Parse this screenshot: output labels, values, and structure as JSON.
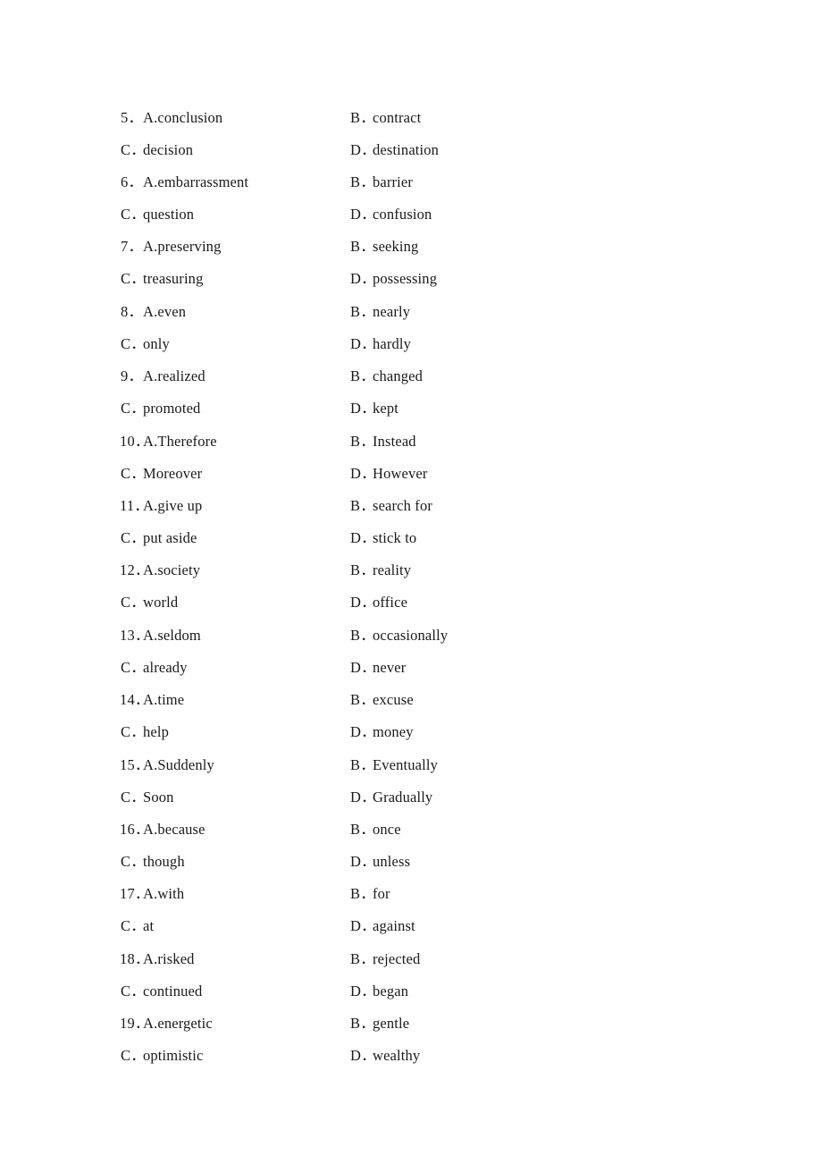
{
  "document": {
    "type": "cloze-test-answer-options",
    "page_background": "#ffffff",
    "text_color": "#1a1a1a",
    "a_label": "A.",
    "c_label": "C",
    "b_label": "B",
    "d_label": "D",
    "period": "．"
  },
  "questions": [
    {
      "number": "5",
      "number_label": "5．",
      "a_label": "A.conclusion",
      "b_letter": "B",
      "b_text": "contract",
      "c_letter": "C",
      "c_text": "decision",
      "d_letter": "D",
      "d_text": "destination"
    },
    {
      "number": "6",
      "number_label": "6．",
      "a_label": "A.embarrassment",
      "b_letter": "B",
      "b_text": "barrier",
      "c_letter": "C",
      "c_text": "question",
      "d_letter": "D",
      "d_text": "confusion"
    },
    {
      "number": "7",
      "number_label": "7．",
      "a_label": "A.preserving",
      "b_letter": "B",
      "b_text": "seeking",
      "c_letter": "C",
      "c_text": "treasuring",
      "d_letter": "D",
      "d_text": "possessing"
    },
    {
      "number": "8",
      "number_label": "8．",
      "a_label": "A.even",
      "b_letter": "B",
      "b_text": "nearly",
      "c_letter": "C",
      "c_text": "only",
      "d_letter": "D",
      "d_text": "hardly"
    },
    {
      "number": "9",
      "number_label": "9．",
      "a_label": "A.realized",
      "b_letter": "B",
      "b_text": "changed",
      "c_letter": "C",
      "c_text": "promoted",
      "d_letter": "D",
      "d_text": "kept"
    },
    {
      "number": "10",
      "number_label": "10．",
      "a_label": "A.Therefore",
      "b_letter": "B",
      "b_text": "Instead",
      "c_letter": "C",
      "c_text": "Moreover",
      "d_letter": "D",
      "d_text": "However"
    },
    {
      "number": "11",
      "number_label": "11．",
      "a_label": "A.give up",
      "b_letter": "B",
      "b_text": "search for",
      "c_letter": "C",
      "c_text": "put aside",
      "d_letter": "D",
      "d_text": "stick to"
    },
    {
      "number": "12",
      "number_label": "12．",
      "a_label": "A.society",
      "b_letter": "B",
      "b_text": "reality",
      "c_letter": "C",
      "c_text": "world",
      "d_letter": "D",
      "d_text": "office"
    },
    {
      "number": "13",
      "number_label": "13．",
      "a_label": "A.seldom",
      "b_letter": "B",
      "b_text": "occasionally",
      "c_letter": "C",
      "c_text": "already",
      "d_letter": "D",
      "d_text": "never"
    },
    {
      "number": "14",
      "number_label": "14．",
      "a_label": "A.time",
      "b_letter": "B",
      "b_text": "excuse",
      "c_letter": "C",
      "c_text": "help",
      "d_letter": "D",
      "d_text": "money"
    },
    {
      "number": "15",
      "number_label": "15．",
      "a_label": "A.Suddenly",
      "b_letter": "B",
      "b_text": "Eventually",
      "c_letter": "C",
      "c_text": "Soon",
      "d_letter": "D",
      "d_text": "Gradually"
    },
    {
      "number": "16",
      "number_label": "16．",
      "a_label": "A.because",
      "b_letter": "B",
      "b_text": "once",
      "c_letter": "C",
      "c_text": "though",
      "d_letter": "D",
      "d_text": "unless"
    },
    {
      "number": "17",
      "number_label": "17．",
      "a_label": "A.with",
      "b_letter": "B",
      "b_text": "for",
      "c_letter": "C",
      "c_text": "at",
      "d_letter": "D",
      "d_text": "against"
    },
    {
      "number": "18",
      "number_label": "18．",
      "a_label": "A.risked",
      "b_letter": "B",
      "b_text": "rejected",
      "c_letter": "C",
      "c_text": "continued",
      "d_letter": "D",
      "d_text": "began"
    },
    {
      "number": "19",
      "number_label": "19．",
      "a_label": "A.energetic",
      "b_letter": "B",
      "b_text": "gentle",
      "c_letter": "C",
      "c_text": "optimistic",
      "d_letter": "D",
      "d_text": "wealthy"
    }
  ]
}
